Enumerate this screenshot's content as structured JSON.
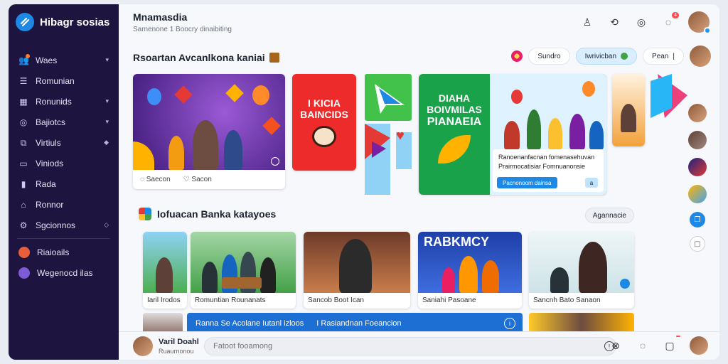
{
  "sidebar": {
    "brand": "Hibagr sosias",
    "items": [
      {
        "label": "Waes",
        "icon": "users-icon",
        "chevron": "▾"
      },
      {
        "label": "Romunian",
        "icon": "list-icon",
        "chevron": ""
      },
      {
        "label": "Ronunids",
        "icon": "grid-icon",
        "chevron": "▾"
      },
      {
        "label": "Bajiotcs",
        "icon": "target-icon",
        "chevron": "▾"
      },
      {
        "label": "Virtiuls",
        "icon": "layers-icon",
        "chevron": "◆"
      },
      {
        "label": "Viniods",
        "icon": "folder-icon",
        "chevron": ""
      },
      {
        "label": "Rada",
        "icon": "chart-icon",
        "chevron": ""
      },
      {
        "label": "Ronnor",
        "icon": "home-icon",
        "chevron": ""
      },
      {
        "label": "Sgcionnos",
        "icon": "settings-icon",
        "chevron": "◇"
      }
    ],
    "extras": [
      {
        "label": "Riaioails",
        "icon": "globe-icon",
        "color": "#e85d3a"
      },
      {
        "label": "Wegenocd ilas",
        "icon": "world-icon",
        "color": "#7b5cd6"
      }
    ]
  },
  "header": {
    "title": "Mnamasdia",
    "subtitle": "Sarnenone 1 Boocry dinaibiting",
    "notification_badge": "4"
  },
  "section1": {
    "title": "Rsoartan Avcanlkona kaniai"
  },
  "filters": {
    "chip1": "Sundro",
    "chip2": "Iwrivicban",
    "chip3": "Pean",
    "chip3_sep": "|"
  },
  "featured": {
    "meta1": "Saecon",
    "meta2": "Sacon"
  },
  "red_card": {
    "line1": "I KICIA",
    "line2": "BAINCIDS"
  },
  "green_card": {
    "line1": "DIAHA",
    "line2": "BOIVMILAS",
    "line3": "PIANAEIA",
    "caption_line1": "Ranoenanfacnan fomenasehuvan",
    "caption_line2": "Prairmocatisiar Fomnuanonsie",
    "button": "Pacnonoom dainsa",
    "icon_label": "a"
  },
  "section2": {
    "title": "Iofuacan Banka katayoes",
    "view_button": "Agannacie"
  },
  "videos": [
    {
      "caption": "Iaril Irodos"
    },
    {
      "caption": "Romuntian Rounanats"
    },
    {
      "caption": "Sancob Boot Ican"
    },
    {
      "caption": "Saniahi Pasoane",
      "title": "RABKMCY"
    },
    {
      "caption": "Sancnh Bato Sanaon"
    }
  ],
  "banner": {
    "text1": "Ranna Se Acolane Iutanl izloos",
    "text2": "I Rasiandnan Foeancion",
    "info": "i"
  },
  "bottom": {
    "name": "Varil Doahl",
    "subtitle": "Ruaurnonou",
    "compose_placeholder": "Fatoot fooamong",
    "compose_icon": "!"
  },
  "colors": {
    "sidebar_bg": "#1d1540",
    "accent": "#1e88e5",
    "red": "#ee2b2b",
    "green": "#19a24a"
  }
}
